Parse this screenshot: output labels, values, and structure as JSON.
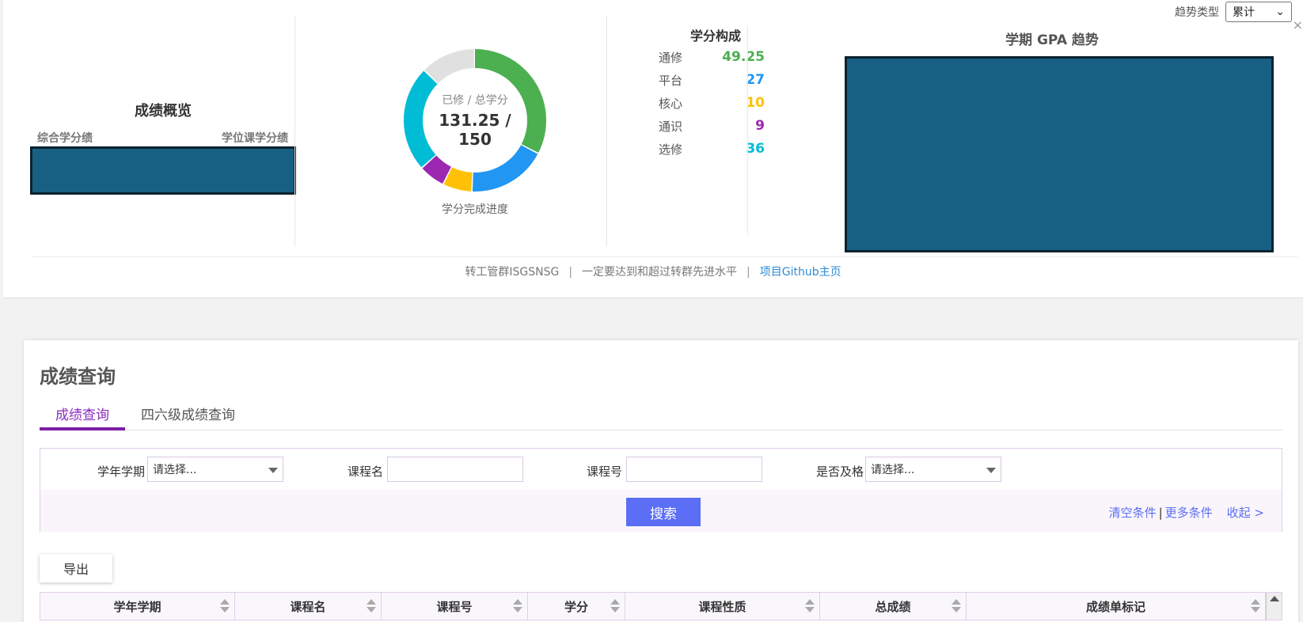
{
  "trend": {
    "label": "趋势类型",
    "selected": "累计"
  },
  "overview": {
    "title": "成绩概览",
    "left_label": "综合学分绩",
    "right_label": "学位课学分绩"
  },
  "progress": {
    "sub_label": "已修 / 总学分",
    "value": "131.25 /",
    "value2": "150",
    "caption": "学分完成进度",
    "earned": 131.25,
    "total": 150
  },
  "credit_composition": {
    "title": "学分构成",
    "items": [
      {
        "name": "通修",
        "value": "49.25",
        "color": "#4caf50"
      },
      {
        "name": "平台",
        "value": "27",
        "color": "#2196f3"
      },
      {
        "name": "核心",
        "value": "10",
        "color": "#ffc107"
      },
      {
        "name": "通识",
        "value": "9",
        "color": "#9c27b0"
      },
      {
        "name": "选修",
        "value": "36",
        "color": "#00bcd4"
      }
    ],
    "remaining_color": "#e0e0e0"
  },
  "gpa": {
    "title": "学期 GPA 趋势"
  },
  "footer": {
    "group": "转工管群ISGSNSG",
    "slogan": "一定要达到和超过转群先进水平",
    "link": "项目Github主页"
  },
  "query": {
    "title": "成绩查询",
    "tabs": [
      {
        "label": "成绩查询"
      },
      {
        "label": "四六级成绩查询"
      }
    ],
    "filters": {
      "term_label": "学年学期",
      "term_value": "请选择...",
      "course_name_label": "课程名",
      "course_no_label": "课程号",
      "pass_label": "是否及格",
      "pass_value": "请选择..."
    },
    "search_label": "搜索",
    "clear_label": "清空条件",
    "more_label": "更多条件",
    "collapse_label": "收起 >",
    "export_label": "导出",
    "columns": [
      "学年学期",
      "课程名",
      "课程号",
      "学分",
      "课程性质",
      "总成绩",
      "成绩单标记"
    ]
  }
}
